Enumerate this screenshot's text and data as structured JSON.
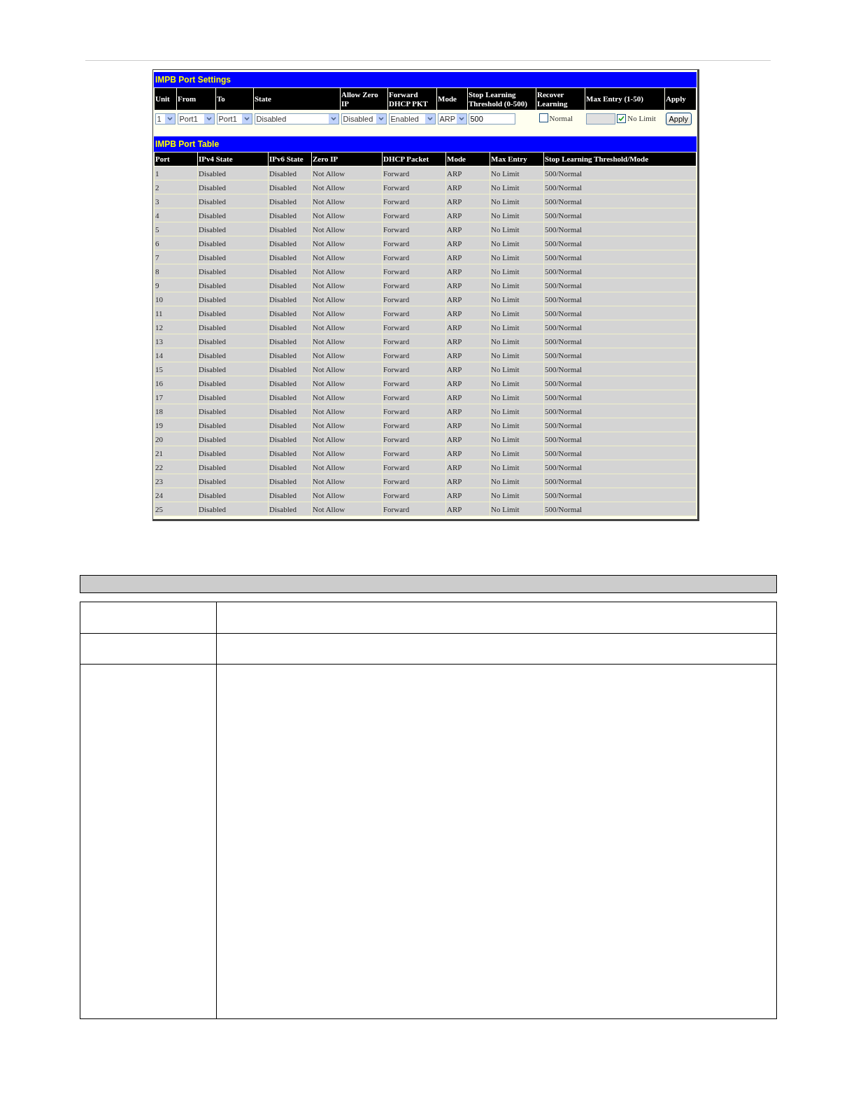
{
  "settings": {
    "title": "IMPB Port Settings",
    "columns": [
      "Unit",
      "From",
      "To",
      "State",
      "Allow Zero IP",
      "Forward DHCP PKT",
      "Mode",
      "Stop Learning Threshold (0-500)",
      "Recover Learning",
      "Max Entry (1-50)",
      "Apply"
    ],
    "unit": "1",
    "from": "Port1",
    "to": "Port1",
    "state": "Disabled",
    "allow_zero_ip": "Disabled",
    "forward_dhcp_pkt": "Enabled",
    "mode": "ARP",
    "threshold": "500",
    "recover_learning": {
      "label": "Normal",
      "checked": false
    },
    "max_entry": {
      "disabled": true
    },
    "no_limit": {
      "label": "No Limit",
      "checked": true
    },
    "apply_button": "Apply"
  },
  "port_table": {
    "title": "IMPB Port Table",
    "columns": [
      "Port",
      "IPv4 State",
      "IPv6 State",
      "Zero IP",
      "DHCP Packet",
      "Mode",
      "Max Entry",
      "Stop Learning Threshold/Mode"
    ],
    "rows": [
      [
        "1",
        "Disabled",
        "Disabled",
        "Not Allow",
        "Forward",
        "ARP",
        "No Limit",
        "500/Normal"
      ],
      [
        "2",
        "Disabled",
        "Disabled",
        "Not Allow",
        "Forward",
        "ARP",
        "No Limit",
        "500/Normal"
      ],
      [
        "3",
        "Disabled",
        "Disabled",
        "Not Allow",
        "Forward",
        "ARP",
        "No Limit",
        "500/Normal"
      ],
      [
        "4",
        "Disabled",
        "Disabled",
        "Not Allow",
        "Forward",
        "ARP",
        "No Limit",
        "500/Normal"
      ],
      [
        "5",
        "Disabled",
        "Disabled",
        "Not Allow",
        "Forward",
        "ARP",
        "No Limit",
        "500/Normal"
      ],
      [
        "6",
        "Disabled",
        "Disabled",
        "Not Allow",
        "Forward",
        "ARP",
        "No Limit",
        "500/Normal"
      ],
      [
        "7",
        "Disabled",
        "Disabled",
        "Not Allow",
        "Forward",
        "ARP",
        "No Limit",
        "500/Normal"
      ],
      [
        "8",
        "Disabled",
        "Disabled",
        "Not Allow",
        "Forward",
        "ARP",
        "No Limit",
        "500/Normal"
      ],
      [
        "9",
        "Disabled",
        "Disabled",
        "Not Allow",
        "Forward",
        "ARP",
        "No Limit",
        "500/Normal"
      ],
      [
        "10",
        "Disabled",
        "Disabled",
        "Not Allow",
        "Forward",
        "ARP",
        "No Limit",
        "500/Normal"
      ],
      [
        "11",
        "Disabled",
        "Disabled",
        "Not Allow",
        "Forward",
        "ARP",
        "No Limit",
        "500/Normal"
      ],
      [
        "12",
        "Disabled",
        "Disabled",
        "Not Allow",
        "Forward",
        "ARP",
        "No Limit",
        "500/Normal"
      ],
      [
        "13",
        "Disabled",
        "Disabled",
        "Not Allow",
        "Forward",
        "ARP",
        "No Limit",
        "500/Normal"
      ],
      [
        "14",
        "Disabled",
        "Disabled",
        "Not Allow",
        "Forward",
        "ARP",
        "No Limit",
        "500/Normal"
      ],
      [
        "15",
        "Disabled",
        "Disabled",
        "Not Allow",
        "Forward",
        "ARP",
        "No Limit",
        "500/Normal"
      ],
      [
        "16",
        "Disabled",
        "Disabled",
        "Not Allow",
        "Forward",
        "ARP",
        "No Limit",
        "500/Normal"
      ],
      [
        "17",
        "Disabled",
        "Disabled",
        "Not Allow",
        "Forward",
        "ARP",
        "No Limit",
        "500/Normal"
      ],
      [
        "18",
        "Disabled",
        "Disabled",
        "Not Allow",
        "Forward",
        "ARP",
        "No Limit",
        "500/Normal"
      ],
      [
        "19",
        "Disabled",
        "Disabled",
        "Not Allow",
        "Forward",
        "ARP",
        "No Limit",
        "500/Normal"
      ],
      [
        "20",
        "Disabled",
        "Disabled",
        "Not Allow",
        "Forward",
        "ARP",
        "No Limit",
        "500/Normal"
      ],
      [
        "21",
        "Disabled",
        "Disabled",
        "Not Allow",
        "Forward",
        "ARP",
        "No Limit",
        "500/Normal"
      ],
      [
        "22",
        "Disabled",
        "Disabled",
        "Not Allow",
        "Forward",
        "ARP",
        "No Limit",
        "500/Normal"
      ],
      [
        "23",
        "Disabled",
        "Disabled",
        "Not Allow",
        "Forward",
        "ARP",
        "No Limit",
        "500/Normal"
      ],
      [
        "24",
        "Disabled",
        "Disabled",
        "Not Allow",
        "Forward",
        "ARP",
        "No Limit",
        "500/Normal"
      ],
      [
        "25",
        "Disabled",
        "Disabled",
        "Not Allow",
        "Forward",
        "ARP",
        "No Limit",
        "500/Normal"
      ]
    ]
  }
}
